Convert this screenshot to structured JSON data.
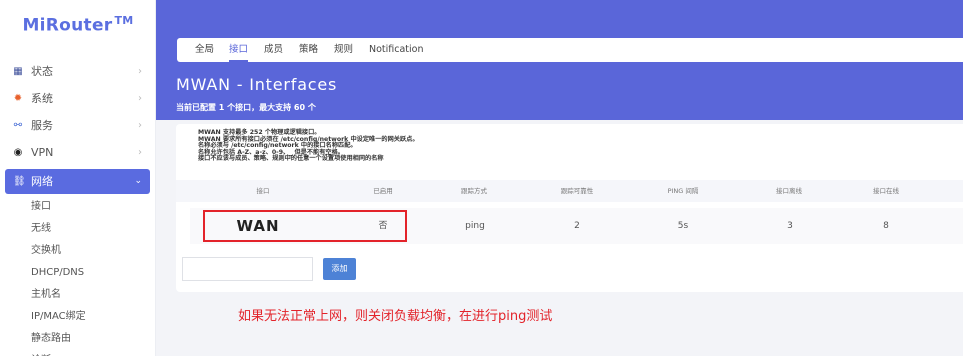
{
  "brand": {
    "name": "MiRouter",
    "tm": "TM"
  },
  "sidebar": {
    "items": [
      {
        "label": "状态",
        "icon": "dashboard-icon"
      },
      {
        "label": "系统",
        "icon": "gear-icon"
      },
      {
        "label": "服务",
        "icon": "link-icon"
      },
      {
        "label": "VPN",
        "icon": "globe-icon"
      },
      {
        "label": "网络",
        "icon": "network-icon"
      }
    ],
    "submenu": [
      "接口",
      "无线",
      "交换机",
      "DHCP/DNS",
      "主机名",
      "IP/MAC绑定",
      "静态路由",
      "诊断"
    ]
  },
  "tabs": [
    {
      "label": "全局"
    },
    {
      "label": "接口"
    },
    {
      "label": "成员"
    },
    {
      "label": "策略"
    },
    {
      "label": "规则"
    },
    {
      "label": "Notification"
    }
  ],
  "header": {
    "title": "MWAN - Interfaces",
    "subtitle": "当前已配置 1 个接口，最大支持 60 个"
  },
  "description": [
    "MWAN 支持最多 252 个物理或逻辑接口。",
    "MWAN 要求所有接口必须在 /etc/config/network 中设定唯一的网关跃点。",
    "名称必须与 /etc/config/network 中的接口名称匹配。",
    "名称允许包括 A-Z、a-z、0-9、_ 但是不能有空格。",
    "接口不应该与成员、策略、规则中的任意一个设置项使用相同的名称"
  ],
  "table": {
    "headers": [
      "接口",
      "已启用",
      "跟踪方式",
      "跟踪可靠性",
      "PING 间隔",
      "接口离线",
      "接口在线"
    ],
    "rows": [
      [
        "WAN",
        "否",
        "ping",
        "2",
        "5s",
        "3",
        "8"
      ]
    ]
  },
  "add": {
    "input_value": "",
    "button_label": "添加"
  },
  "annotation": "如果无法正常上网，则关闭负载均衡，在进行ping测试",
  "colors": {
    "accent": "#5a66d9",
    "highlight": "#e3232a",
    "button": "#4d82d6"
  }
}
